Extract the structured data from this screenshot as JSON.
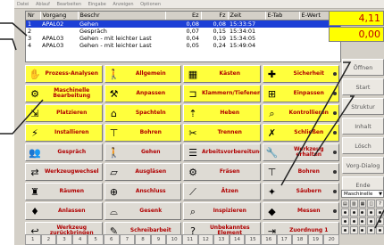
{
  "menu": [
    "Datei",
    "Ablauf",
    "Bearbeiten",
    "Eingabe",
    "Anzeigen",
    "Optionen"
  ],
  "grid": {
    "columns": [
      "Nr",
      "Vorgang",
      "Beschr",
      "Ez",
      "Fz",
      "Zeit",
      "E-Tab",
      "E-Wert"
    ],
    "rows": [
      {
        "nr": "1",
        "vorgang": "APAL02",
        "beschr": "Gehen",
        "ez": "0,08",
        "fz": "0,08",
        "zeit": "15:33:57",
        "selected": true
      },
      {
        "nr": "2",
        "vorgang": "",
        "beschr": "Gespräch",
        "ez": "0,07",
        "fz": "0,15",
        "zeit": "15:34:01",
        "selected": false
      },
      {
        "nr": "3",
        "vorgang": "APAL03",
        "beschr": "Gehen - mit leichter Last",
        "ez": "0,04",
        "fz": "0,19",
        "zeit": "15:34:05",
        "selected": false
      },
      {
        "nr": "4",
        "vorgang": "APAL03",
        "beschr": "Gehen - mit leichter Last",
        "ez": "0,05",
        "fz": "0,24",
        "zeit": "15:49:04",
        "selected": false
      }
    ]
  },
  "counters": {
    "top": "4,11",
    "bottom": "0,00"
  },
  "tiles": [
    {
      "label": "Prozess-Analysen",
      "icon": "hand-icon",
      "glyph": "✋",
      "color": "y"
    },
    {
      "label": "Allgemein",
      "icon": "person-icon",
      "glyph": "🚶",
      "color": "y"
    },
    {
      "label": "Kästen",
      "icon": "boxes-icon",
      "glyph": "▦",
      "color": "y"
    },
    {
      "label": "Sicherheit",
      "icon": "cross-icon",
      "glyph": "✚",
      "color": "y"
    },
    {
      "label": "Maschinelle Bearbeitung",
      "icon": "machine-icon",
      "glyph": "⚙",
      "color": "y"
    },
    {
      "label": "Anpassen",
      "icon": "adjust-icon",
      "glyph": "⚒",
      "color": "y"
    },
    {
      "label": "Klammern/Tiefenen",
      "icon": "clamp-icon",
      "glyph": "⊐",
      "color": "y"
    },
    {
      "label": "Einpassen",
      "icon": "fit-icon",
      "glyph": "⊞",
      "color": "y"
    },
    {
      "label": "Platzieren",
      "icon": "place-icon",
      "glyph": "⇲",
      "color": "y"
    },
    {
      "label": "Spachteln",
      "icon": "spatula-icon",
      "glyph": "⌂",
      "color": "y"
    },
    {
      "label": "Heben",
      "icon": "lift-icon",
      "glyph": "⇡",
      "color": "y"
    },
    {
      "label": "Kontrollieren",
      "icon": "magnifier-icon",
      "glyph": "⌕",
      "color": "y"
    },
    {
      "label": "Installieren",
      "icon": "install-icon",
      "glyph": "⚡",
      "color": "y"
    },
    {
      "label": "Bohren",
      "icon": "drill-icon",
      "glyph": "⊤",
      "color": "y"
    },
    {
      "label": "Trennen",
      "icon": "cut-icon",
      "glyph": "✂",
      "color": "y"
    },
    {
      "label": "Schließen",
      "icon": "close-icon",
      "glyph": "✗",
      "color": "y"
    },
    {
      "label": "Gespräch",
      "icon": "people-icon",
      "glyph": "👥",
      "color": "g"
    },
    {
      "label": "Gehen",
      "icon": "walk-icon",
      "glyph": "🚶",
      "color": "g"
    },
    {
      "label": "Arbeitsvorbereitung",
      "icon": "prep-icon",
      "glyph": "☰",
      "color": "g"
    },
    {
      "label": "Werkzeug erhalten",
      "icon": "tool-receive-icon",
      "glyph": "🔧",
      "color": "g"
    },
    {
      "label": "Werkzeugwechsel",
      "icon": "tool-change-icon",
      "glyph": "⇄",
      "color": "g"
    },
    {
      "label": "Ausgläsen",
      "icon": "grind-icon",
      "glyph": "▱",
      "color": "g"
    },
    {
      "label": "Fräsen",
      "icon": "mill-icon",
      "glyph": "⚙",
      "color": "g"
    },
    {
      "label": "Bohren",
      "icon": "drill2-icon",
      "glyph": "⊤",
      "color": "g"
    },
    {
      "label": "Räumen",
      "icon": "broach-icon",
      "glyph": "♜",
      "color": "g"
    },
    {
      "label": "Anschluss",
      "icon": "connect-icon",
      "glyph": "⊕",
      "color": "g"
    },
    {
      "label": "Ätzen",
      "icon": "etch-icon",
      "glyph": "⟋",
      "color": "g"
    },
    {
      "label": "Säubern",
      "icon": "clean-icon",
      "glyph": "✦",
      "color": "g"
    },
    {
      "label": "Anlassen",
      "icon": "start-icon",
      "glyph": "♦",
      "color": "g"
    },
    {
      "label": "Gesenk",
      "icon": "die-icon",
      "glyph": "⌓",
      "color": "g"
    },
    {
      "label": "Inspizieren",
      "icon": "inspect-icon",
      "glyph": "⌕",
      "color": "g"
    },
    {
      "label": "Messen",
      "icon": "measure-icon",
      "glyph": "◆",
      "color": "g"
    },
    {
      "label": "Werkzeug zurückbringen",
      "icon": "tool-return-icon",
      "glyph": "↩",
      "color": "g"
    },
    {
      "label": "Schreibarbeit",
      "icon": "write-icon",
      "glyph": "✎",
      "color": "g"
    },
    {
      "label": "Unbekanntes Element",
      "icon": "unknown-icon",
      "glyph": "?",
      "color": "g"
    },
    {
      "label": "Zuordnung 1",
      "icon": "assign-icon",
      "glyph": "⇥",
      "color": "g"
    }
  ],
  "side_buttons": [
    "Öffnen",
    "Start",
    "Struktur",
    "Inhalt",
    "Lösch",
    "Vorg-Dialog",
    "Ende"
  ],
  "combo": {
    "value": "Maschinelle"
  },
  "numbers": [
    "1",
    "2",
    "3",
    "4",
    "5",
    "6",
    "7",
    "8",
    "9",
    "10",
    "11",
    "12",
    "13",
    "14",
    "15",
    "16",
    "17",
    "18",
    "19",
    "20"
  ]
}
